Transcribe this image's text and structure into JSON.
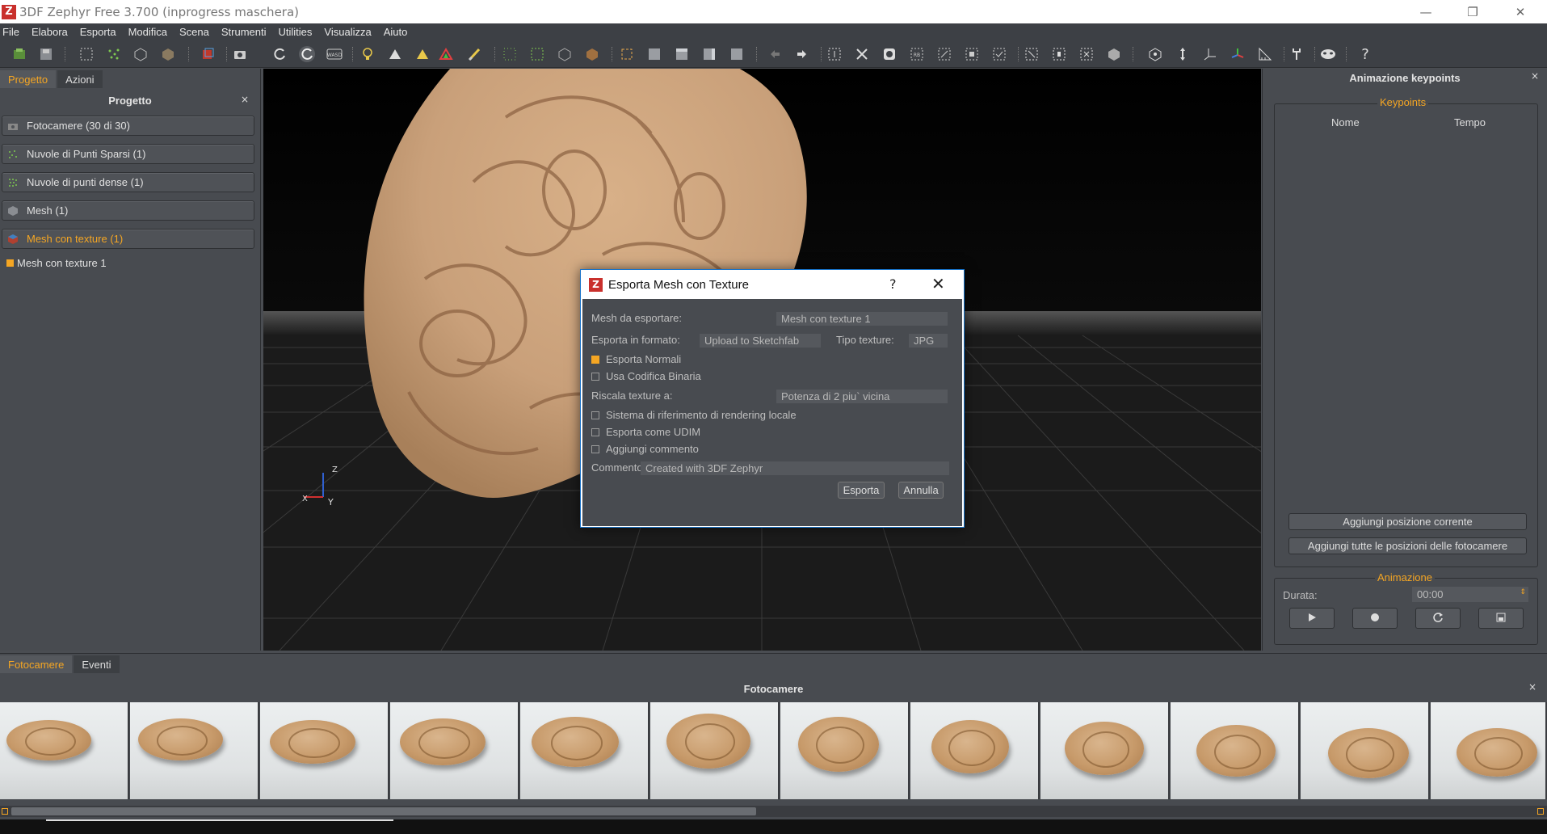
{
  "window": {
    "title": "3DF Zephyr Free 3.700 (inprogress maschera)",
    "logo_letter": "Z",
    "minimize": "—",
    "restore": "❐",
    "close": "✕"
  },
  "menu": [
    "File",
    "Elabora",
    "Esporta",
    "Modifica",
    "Scena",
    "Strumenti",
    "Utilities",
    "Visualizza",
    "Aiuto"
  ],
  "toolbar": {
    "help_label": "?"
  },
  "left_panel": {
    "tabs": [
      "Progetto",
      "Azioni"
    ],
    "title": "Progetto",
    "close": "×",
    "items": [
      {
        "label": "Fotocamere (30 di 30)",
        "icon": "camera-icon"
      },
      {
        "label": "Nuvole di Punti Sparsi (1)",
        "icon": "sparse-cloud-icon"
      },
      {
        "label": "Nuvole di punti dense (1)",
        "icon": "dense-cloud-icon"
      },
      {
        "label": "Mesh (1)",
        "icon": "mesh-icon"
      },
      {
        "label": "Mesh con texture (1)",
        "icon": "textured-mesh-icon"
      }
    ],
    "tree_item": "Mesh con texture 1"
  },
  "viewport": {
    "axis_z": "Z",
    "axis_x": "X",
    "axis_y": "Y"
  },
  "right_panel": {
    "title": "Animazione keypoints",
    "close": "×",
    "keypoints_group": "Keypoints",
    "col_name": "Nome",
    "col_time": "Tempo",
    "add_current": "Aggiungi posizione corrente",
    "add_all": "Aggiungi tutte le posizioni delle fotocamere",
    "animation_group": "Animazione",
    "duration_label": "Durata:",
    "duration_value": "00:00"
  },
  "bottom_panel": {
    "tabs": [
      "Fotocamere",
      "Eventi"
    ],
    "title": "Fotocamere",
    "close": "×"
  },
  "dialog": {
    "title": "Esporta Mesh con Texture",
    "help": "?",
    "close": "✕",
    "mesh_label": "Mesh da esportare:",
    "mesh_value": "Mesh con texture 1",
    "format_label": "Esporta in formato:",
    "format_value": "Upload to Sketchfab",
    "texture_type_label": "Tipo texture:",
    "texture_type_value": "JPG",
    "export_normals": "Esporta Normali",
    "binary_encoding": "Usa Codifica Binaria",
    "rescale_label": "Riscala texture a:",
    "rescale_value": "Potenza di 2 piu` vicina",
    "local_ref": "Sistema di riferimento di rendering locale",
    "udim": "Esporta come UDIM",
    "add_comment": "Aggiungi commento",
    "comment_label": "Commento",
    "comment_value": "Created with 3DF Zephyr",
    "export_button": "Esporta",
    "cancel_button": "Annulla"
  }
}
